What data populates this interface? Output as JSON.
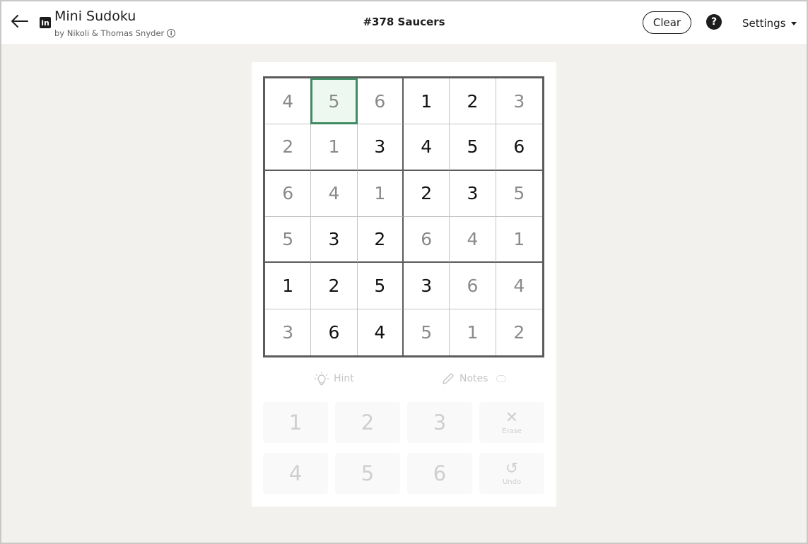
{
  "header": {
    "title": "Mini Sudoku",
    "byline": "by Nikoli & Thomas Snyder",
    "puzzle_name": "#378 Saucers",
    "clear_label": "Clear",
    "help_symbol": "?",
    "settings_label": "Settings",
    "logo_text": "in"
  },
  "colors": {
    "selected_border": "#3f8a63",
    "selected_fill": "#edf8f0",
    "given_digit": "#111111",
    "entered_digit": "#8a8a8a"
  },
  "board": {
    "size": 6,
    "selected": {
      "row": 0,
      "col": 1
    },
    "cells": [
      [
        {
          "v": "4",
          "given": false
        },
        {
          "v": "5",
          "given": false
        },
        {
          "v": "6",
          "given": false
        },
        {
          "v": "1",
          "given": true
        },
        {
          "v": "2",
          "given": true
        },
        {
          "v": "3",
          "given": false
        }
      ],
      [
        {
          "v": "2",
          "given": false
        },
        {
          "v": "1",
          "given": false
        },
        {
          "v": "3",
          "given": true
        },
        {
          "v": "4",
          "given": true
        },
        {
          "v": "5",
          "given": true
        },
        {
          "v": "6",
          "given": true
        }
      ],
      [
        {
          "v": "6",
          "given": false
        },
        {
          "v": "4",
          "given": false
        },
        {
          "v": "1",
          "given": false
        },
        {
          "v": "2",
          "given": true
        },
        {
          "v": "3",
          "given": true
        },
        {
          "v": "5",
          "given": false
        }
      ],
      [
        {
          "v": "5",
          "given": false
        },
        {
          "v": "3",
          "given": true
        },
        {
          "v": "2",
          "given": true
        },
        {
          "v": "6",
          "given": false
        },
        {
          "v": "4",
          "given": false
        },
        {
          "v": "1",
          "given": false
        }
      ],
      [
        {
          "v": "1",
          "given": true
        },
        {
          "v": "2",
          "given": true
        },
        {
          "v": "5",
          "given": true
        },
        {
          "v": "3",
          "given": true
        },
        {
          "v": "6",
          "given": false
        },
        {
          "v": "4",
          "given": false
        }
      ],
      [
        {
          "v": "3",
          "given": false
        },
        {
          "v": "6",
          "given": true
        },
        {
          "v": "4",
          "given": true
        },
        {
          "v": "5",
          "given": false
        },
        {
          "v": "1",
          "given": false
        },
        {
          "v": "2",
          "given": false
        }
      ]
    ]
  },
  "tools": {
    "hint_label": "Hint",
    "notes_label": "Notes"
  },
  "keypad": {
    "digits": [
      "1",
      "2",
      "3",
      "4",
      "5",
      "6"
    ],
    "erase_label": "Erase",
    "undo_label": "Undo"
  }
}
